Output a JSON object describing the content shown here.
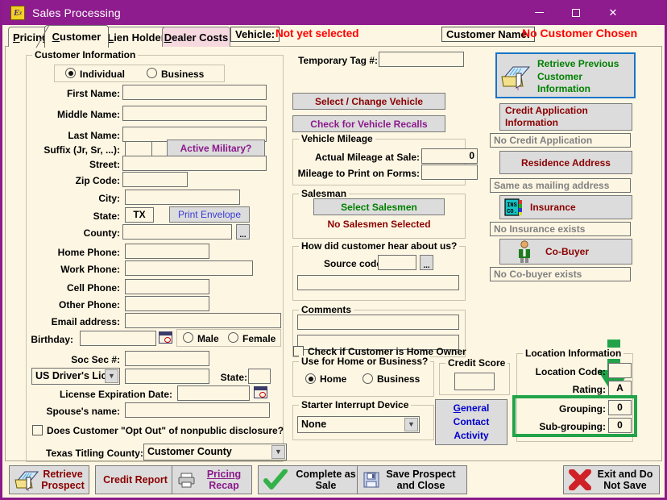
{
  "window": {
    "title": "Sales Processing",
    "app_icon": "app-icon",
    "minimize": "minimize-icon",
    "maximize": "maximize-icon",
    "close": "close-icon"
  },
  "tabs": [
    {
      "label": "Pricing",
      "mnemonic": "P",
      "selected": false
    },
    {
      "label": "Customer",
      "mnemonic": "C",
      "selected": true
    },
    {
      "label": "Lien Holder",
      "mnemonic": "L",
      "selected": false
    },
    {
      "label": "Dealer Costs",
      "mnemonic": "D",
      "selected": false
    }
  ],
  "header": {
    "vehicle_label": "Vehicle:",
    "vehicle_status": "Not yet selected",
    "customer_name_label": "Customer Name:",
    "customer_name_status": "No Customer Chosen"
  },
  "customer_information": {
    "legend": "Customer Information",
    "type_individual": "Individual",
    "type_business": "Business",
    "type_selected": "Individual",
    "fields": [
      {
        "label": "First Name:",
        "value": ""
      },
      {
        "label": "Middle Name:",
        "value": ""
      },
      {
        "label": "Last Name:",
        "value": ""
      },
      {
        "label": "Suffix (Jr, Sr, ...):",
        "value": ""
      },
      {
        "label": "Street:",
        "value": ""
      },
      {
        "label": "Zip Code:",
        "value": ""
      },
      {
        "label": "City:",
        "value": ""
      },
      {
        "label": "State:",
        "value": "TX"
      },
      {
        "label": "County:",
        "value": ""
      },
      {
        "label": "Home Phone:",
        "value": ""
      },
      {
        "label": "Work Phone:",
        "value": ""
      },
      {
        "label": "Cell Phone:",
        "value": ""
      },
      {
        "label": "Other Phone:",
        "value": ""
      },
      {
        "label": "Email address:",
        "value": ""
      },
      {
        "label": "Birthday:",
        "value": ""
      },
      {
        "label": "Soc Sec #:",
        "value": ""
      },
      {
        "label": "State:",
        "value": ""
      },
      {
        "label": "License Expiration Date:",
        "value": ""
      },
      {
        "label": "Spouse's name:",
        "value": ""
      }
    ],
    "active_military_button": "Active Military?",
    "print_envelope_button": "Print Envelope",
    "county_browse": "...",
    "gender_male": "Male",
    "gender_female": "Female",
    "id_type_selected": "US Driver's Lic",
    "id_number": "",
    "opt_out_checkbox": "Does Customer \"Opt Out\" of nonpublic disclosure?",
    "opt_out_checked": false,
    "titling_county_label": "Texas Titling County:",
    "titling_county_value": "Customer County"
  },
  "middle": {
    "temporary_tag_label": "Temporary Tag #:",
    "temporary_tag_value": "",
    "select_change_vehicle": "Select / Change Vehicle",
    "check_vehicle_recalls": "Check for Vehicle Recalls",
    "vehicle_mileage": {
      "legend": "Vehicle Mileage",
      "actual_mileage_label": "Actual Mileage at Sale:",
      "actual_mileage_value": "0",
      "print_mileage_label": "Mileage to Print on Forms:",
      "print_mileage_value": ""
    },
    "salesman": {
      "legend": "Salesman",
      "select_button": "Select Salesmen",
      "status": "No Salesmen Selected"
    },
    "hear_about": {
      "legend": "How did customer hear about us?",
      "source_code_label": "Source code:",
      "source_code_value": "",
      "browse": "...",
      "description_value": ""
    },
    "comments": {
      "legend": "Comments",
      "line1": "",
      "line2": ""
    },
    "home_owner_checkbox": "Check if Customer is Home Owner",
    "home_owner_checked": false,
    "use_for": {
      "legend": "Use for Home or Business?",
      "home": "Home",
      "business": "Business",
      "selected": "Home"
    },
    "credit_score": {
      "legend": "Credit Score",
      "value": ""
    },
    "starter_interrupt": {
      "legend": "Starter Interrupt Device",
      "value": "None"
    },
    "general_contact_activity": [
      "General",
      "Contact",
      "Activity"
    ],
    "general_contact_mnemonic": "G"
  },
  "right": {
    "retrieve_previous": [
      "Retrieve Previous",
      "Customer",
      "Information"
    ],
    "credit_application": [
      "Credit Application",
      "Information"
    ],
    "no_credit_application": "No Credit Application",
    "residence_address": "Residence Address",
    "same_as_mailing": "Same as mailing address",
    "insurance": "Insurance",
    "insurance_icon_text": [
      "INS",
      "CO."
    ],
    "no_insurance": "No Insurance exists",
    "cobuyer": "Co-Buyer",
    "no_cobuyer": "No Co-buyer exists",
    "location_information": {
      "legend": "Location Information",
      "location_code_label": "Location Code:",
      "location_code_value": "",
      "rating_label": "Rating:",
      "rating_value": "A",
      "grouping_label": "Grouping:",
      "grouping_value": "0",
      "subgrouping_label": "Sub-grouping:",
      "subgrouping_value": "0"
    }
  },
  "annotations": {
    "arrow_color": "#22A34A",
    "highlight_color": "#22A34A"
  },
  "footer_buttons": [
    {
      "name": "retrieve-prospect",
      "lines": [
        "Retrieve",
        "Prospect"
      ],
      "icon": "folder-hand-icon"
    },
    {
      "name": "credit-report",
      "lines": [
        "Credit Report"
      ],
      "icon": ""
    },
    {
      "name": "pricing-recap",
      "lines": [
        "Pricing",
        "Recap"
      ],
      "icon": "printer-icon"
    },
    {
      "name": "complete-as-sale",
      "lines": [
        "Complete as",
        "Sale"
      ],
      "icon": "green-check-icon"
    },
    {
      "name": "save-prospect-and-close",
      "lines": [
        "Save Prospect",
        "and Close"
      ],
      "icon": "floppy-disk-icon"
    },
    {
      "name": "exit-and-do-not-save",
      "lines": [
        "Exit and Do",
        "Not Save"
      ],
      "icon": "red-x-icon"
    }
  ],
  "colors": {
    "title_bar": "#8E1C8E",
    "form_bg": "#FDF6E3",
    "accent_red": "#FF0000",
    "dark_red": "#8B0000",
    "purple_text": "#8B1A8B",
    "green_text": "#008000",
    "blue_text": "#0000CC"
  }
}
